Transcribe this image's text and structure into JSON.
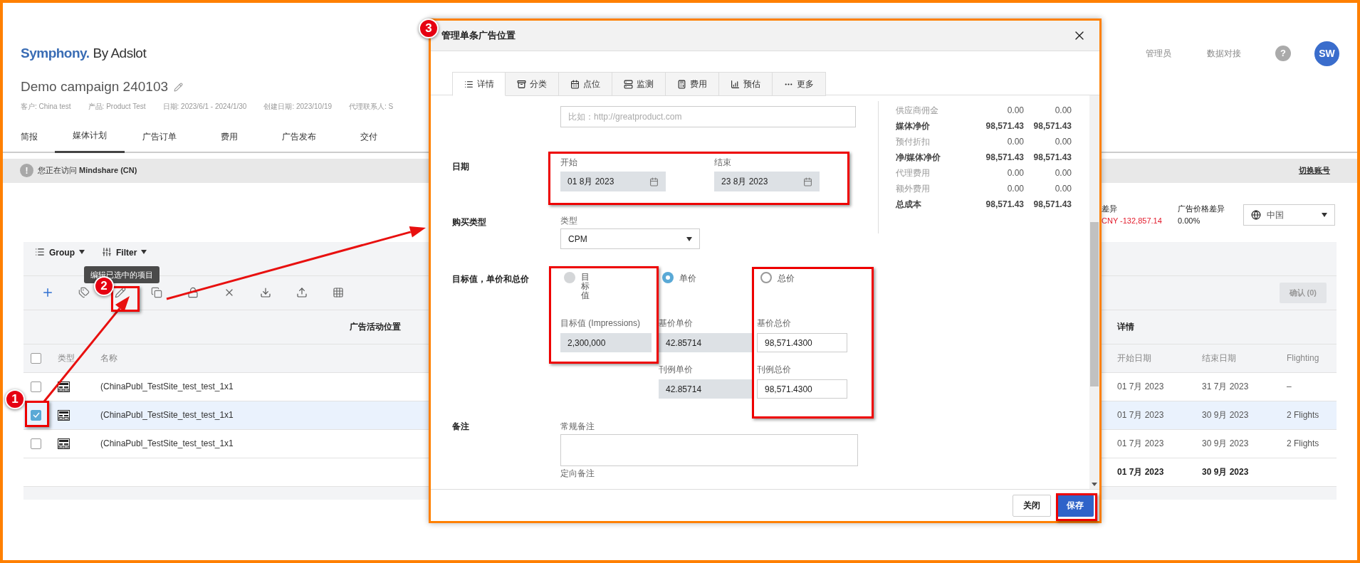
{
  "header": {
    "logo_brand": "Symphony.",
    "logo_suffix": "By Adslot",
    "nav": [
      {
        "label": "管理员"
      },
      {
        "label": "数据对接"
      }
    ],
    "help": "?",
    "avatar": "SW"
  },
  "campaign": {
    "title": "Demo campaign 240103",
    "meta": [
      "客户: China test",
      "产品: Product Test",
      "日期: 2023/6/1 - 2024/1/30",
      "创建日期: 2023/10/19",
      "代理联系人: S"
    ]
  },
  "tabs": [
    {
      "label": "简报",
      "selected": false
    },
    {
      "label": "媒体计划",
      "selected": true
    },
    {
      "label": "广告订单",
      "selected": false
    },
    {
      "label": "费用",
      "selected": false
    },
    {
      "label": "广告发布",
      "selected": false
    },
    {
      "label": "交付",
      "selected": false
    }
  ],
  "notice": {
    "icon": "!",
    "text": "您正在访问 **Mindshare (CN)**",
    "switch": "切换账号"
  },
  "summary": [
    {
      "label": "差异",
      "value": "CNY -132,857.14",
      "negative": true
    },
    {
      "label": "广告价格差异",
      "value": "0.00%",
      "negative": false
    }
  ],
  "region_select": {
    "value": "中国"
  },
  "toolbar": {
    "group": "Group",
    "filter": "Filter",
    "confirm": {
      "label": "确认 (0)",
      "disabled": true
    }
  },
  "tooltip": "编辑已选中的项目",
  "table": {
    "group_headers": [
      "广告活动位置",
      "详情"
    ],
    "header_checked": false,
    "columns": [
      "类型",
      "名称",
      "开始日期",
      "结束日期",
      "Flighting"
    ],
    "rows": [
      {
        "checked": false,
        "selected": false,
        "name": "(ChinaPubl_TestSite_test_test_1x1",
        "start": "01 7月 2023",
        "end": "31 7月 2023",
        "flighting": "–"
      },
      {
        "checked": true,
        "selected": true,
        "name": "(ChinaPubl_TestSite_test_test_1x1",
        "start": "01 7月 2023",
        "end": "30 9月 2023",
        "flighting": "2 Flights"
      },
      {
        "checked": false,
        "selected": false,
        "name": "(ChinaPubl_TestSite_test_test_1x1",
        "start": "01 7月 2023",
        "end": "30 9月 2023",
        "flighting": "2 Flights"
      }
    ],
    "total": {
      "start": "01 7月 2023",
      "end": "30 9月 2023"
    }
  },
  "modal": {
    "title": "管理单条广告位置",
    "tabs": [
      {
        "label": "详情",
        "selected": true
      },
      {
        "label": "分类",
        "selected": false
      },
      {
        "label": "点位",
        "selected": false
      },
      {
        "label": "监测",
        "selected": false
      },
      {
        "label": "费用",
        "selected": false
      },
      {
        "label": "预估",
        "selected": false
      },
      {
        "label": "更多",
        "selected": false
      }
    ],
    "url_placeholder": "比如：http://greatproduct.com",
    "dates": {
      "label": "日期",
      "start_label": "开始",
      "start": "01 8月 2023",
      "end_label": "结束",
      "end": "23 8月 2023"
    },
    "buy_type": {
      "label": "购买类型",
      "field_label": "类型",
      "value": "CPM"
    },
    "pricing": {
      "label": "目标值，单价和总价",
      "options": [
        {
          "label": "目标值",
          "selected": false,
          "disabled": true
        },
        {
          "label": "单价",
          "selected": true,
          "disabled": false
        },
        {
          "label": "总价",
          "selected": false,
          "disabled": false
        }
      ],
      "fields": [
        [
          {
            "label": "目标值 (Impressions)",
            "value": "2,300,000",
            "disabled": true
          }
        ],
        [
          {
            "label": "基价单价",
            "value": "42.85714",
            "disabled": true
          },
          {
            "label": "刊例单价",
            "value": "42.85714",
            "disabled": true
          }
        ],
        [
          {
            "label": "基价总价",
            "value": "98,571.4300",
            "disabled": false
          },
          {
            "label": "刊例总价",
            "value": "98,571.4300",
            "disabled": false
          }
        ]
      ]
    },
    "notes": {
      "label": "备注",
      "general_label": "常规备注",
      "targeting_label": "定向备注"
    },
    "cost_summary": [
      {
        "label": "供应商佣金",
        "value_1": "0.00",
        "value_2": "0.00",
        "bold": false
      },
      {
        "label": "媒体净价",
        "value_1": "98,571.43",
        "value_2": "98,571.43",
        "bold": true
      },
      {
        "label": "预付折扣",
        "value_1": "0.00",
        "value_2": "0.00",
        "bold": false
      },
      {
        "label": "净/媒体净价",
        "value_1": "98,571.43",
        "value_2": "98,571.43",
        "bold": true
      },
      {
        "label": "代理费用",
        "value_1": "0.00",
        "value_2": "0.00",
        "bold": false
      },
      {
        "label": "额外费用",
        "value_1": "0.00",
        "value_2": "0.00",
        "bold": false
      },
      {
        "label": "总成本",
        "value_1": "98,571.43",
        "value_2": "98,571.43",
        "bold": true
      }
    ],
    "buttons": [
      {
        "label": "关闭",
        "primary": false
      },
      {
        "label": "保存",
        "primary": true
      }
    ]
  },
  "markers": [
    "1",
    "2",
    "3"
  ]
}
